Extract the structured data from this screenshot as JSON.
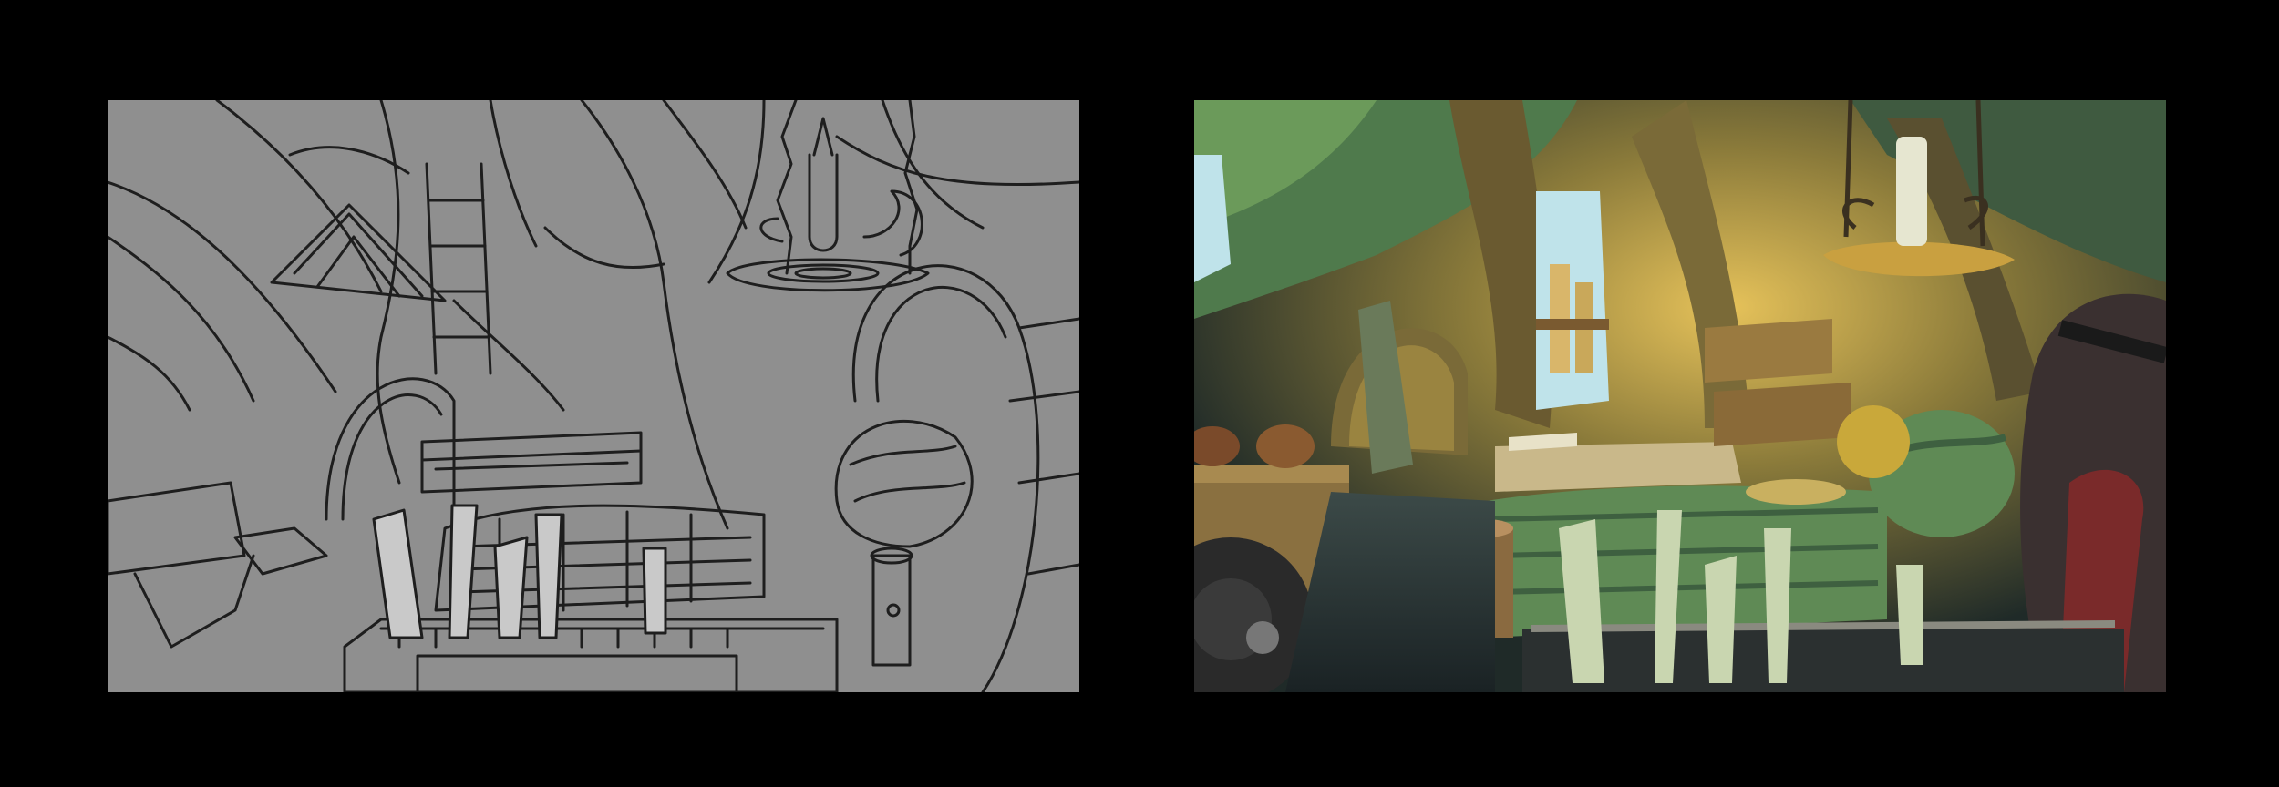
{
  "canvas": {
    "background": "#000000"
  },
  "panels": [
    {
      "name": "line-art-sketch",
      "palette": {
        "base": "#8f8f8f",
        "line": "#1e1e1e",
        "light": "#c9c9c9"
      }
    },
    {
      "name": "color-painting",
      "palette": {
        "dark": "#1f2a28",
        "wood": "#6a5a30",
        "green": "#5f8a55",
        "glow": "#e6c25a",
        "sky": "#bfe3ea"
      }
    }
  ]
}
